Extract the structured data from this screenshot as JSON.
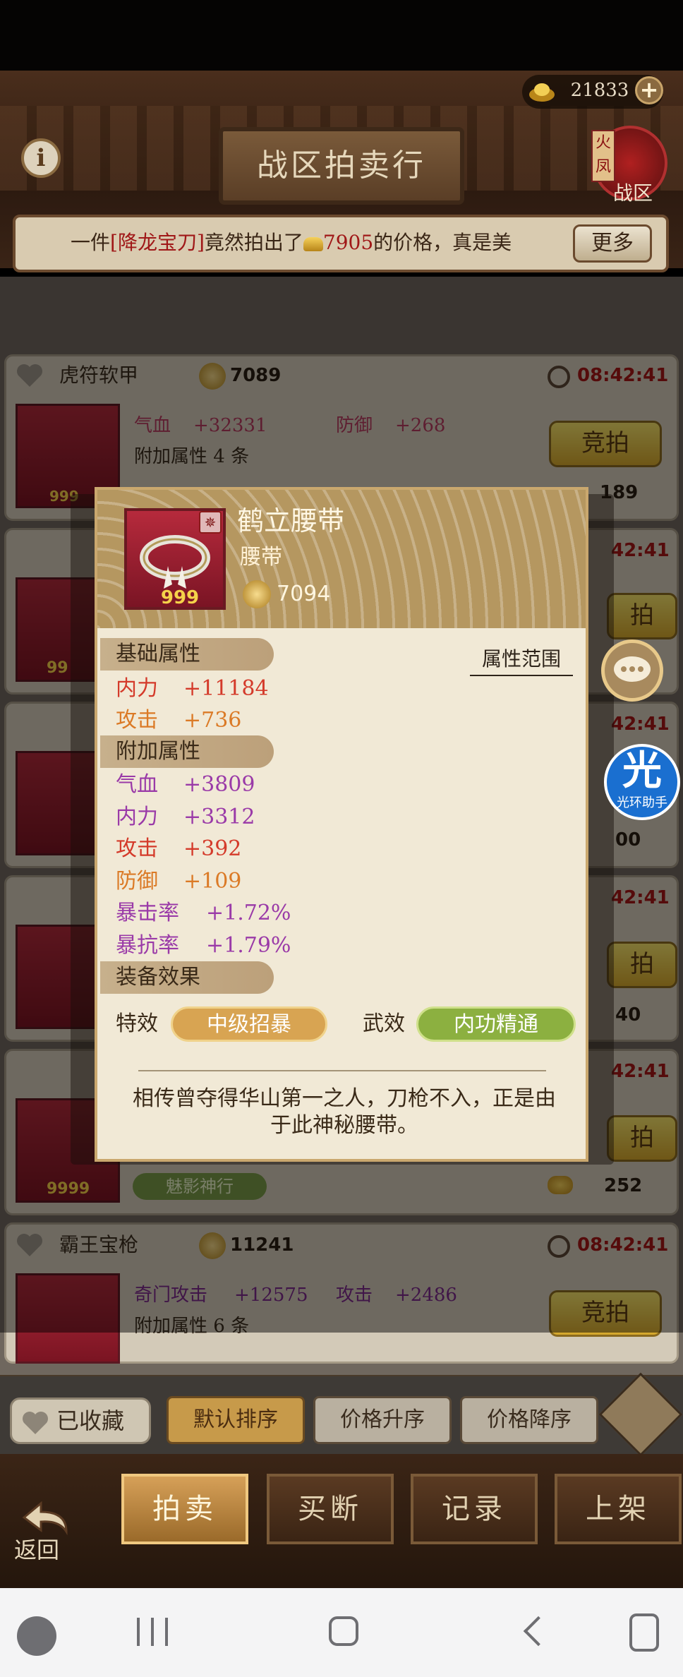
{
  "header": {
    "gold_amount": "21833",
    "title": "战区拍卖行",
    "server_tag": "火凤",
    "server_label": "战区"
  },
  "ticker": {
    "prefix": "一件",
    "item": "[降龙宝刀]",
    "middle": "竟然拍出了",
    "price": "7905",
    "suffix": "的价格，真是美",
    "more_label": "更多"
  },
  "listings": [
    {
      "name": "虎符软甲",
      "price": "7089",
      "time": "08:42:41",
      "stat1_name": "气血",
      "stat1_value": "+32331",
      "stat2_name": "防御",
      "stat2_value": "+268",
      "extra": "附加属性 4 条",
      "bid_label": "竞拍",
      "bid_count": "189",
      "count": "999"
    },
    {
      "name": "霸王宝枪",
      "price": "11241",
      "time": "08:42:41",
      "stat1_name": "奇门攻击",
      "stat1_value": "+12575",
      "stat2_name": "攻击",
      "stat2_value": "+2486",
      "extra": "附加属性 6 条",
      "bid_label": "竞拍"
    }
  ],
  "background_fragments": {
    "time": "42:41",
    "bid_short": "拍",
    "count_a": "00",
    "count_b": "40",
    "count_c": "252",
    "tag_label": "魅影神行",
    "thumb_count": "99",
    "thumb_count_long": "9999"
  },
  "modal": {
    "item_name": "鹤立腰带",
    "item_type": "腰带",
    "item_price": "7094",
    "item_count": "999",
    "section_base": "基础属性",
    "attr_range_link": "属性范围",
    "base_attrs": [
      {
        "name": "内力",
        "value": "+11184",
        "color": "#d43a2a"
      },
      {
        "name": "攻击",
        "value": "+736",
        "color": "#db7a26"
      }
    ],
    "section_extra": "附加属性",
    "extra_attrs": [
      {
        "name": "气血",
        "value": "+3809",
        "color": "#9a3aa8"
      },
      {
        "name": "内力",
        "value": "+3312",
        "color": "#9a3aa8"
      },
      {
        "name": "攻击",
        "value": "+392",
        "color": "#d43a2a"
      },
      {
        "name": "防御",
        "value": "+109",
        "color": "#db7a26"
      },
      {
        "name": "暴击率",
        "value": "+1.72%",
        "color": "#9a3aa8"
      },
      {
        "name": "暴抗率",
        "value": "+1.79%",
        "color": "#9a3aa8"
      }
    ],
    "section_effect": "装备效果",
    "special_label": "特效",
    "special_value": "中级招暴",
    "martial_label": "武效",
    "martial_value": "内功精通",
    "description": "相传曾夺得华山第一之人，刀枪不入，正是由于此神秘腰带。"
  },
  "floating": {
    "helper_char": "光",
    "helper_label": "光环助手"
  },
  "filter": {
    "favorites_label": "已收藏",
    "sort_default": "默认排序",
    "sort_price_asc": "价格升序",
    "sort_price_desc": "价格降序"
  },
  "tabs": {
    "auction": "拍卖",
    "buyout": "买断",
    "records": "记录",
    "list": "上架",
    "back": "返回"
  },
  "colors": {
    "accent_gold": "#d4a72c",
    "active_sort": "#c79a4a",
    "special_pill": "#d8a452",
    "martial_pill": "#8cb040"
  }
}
